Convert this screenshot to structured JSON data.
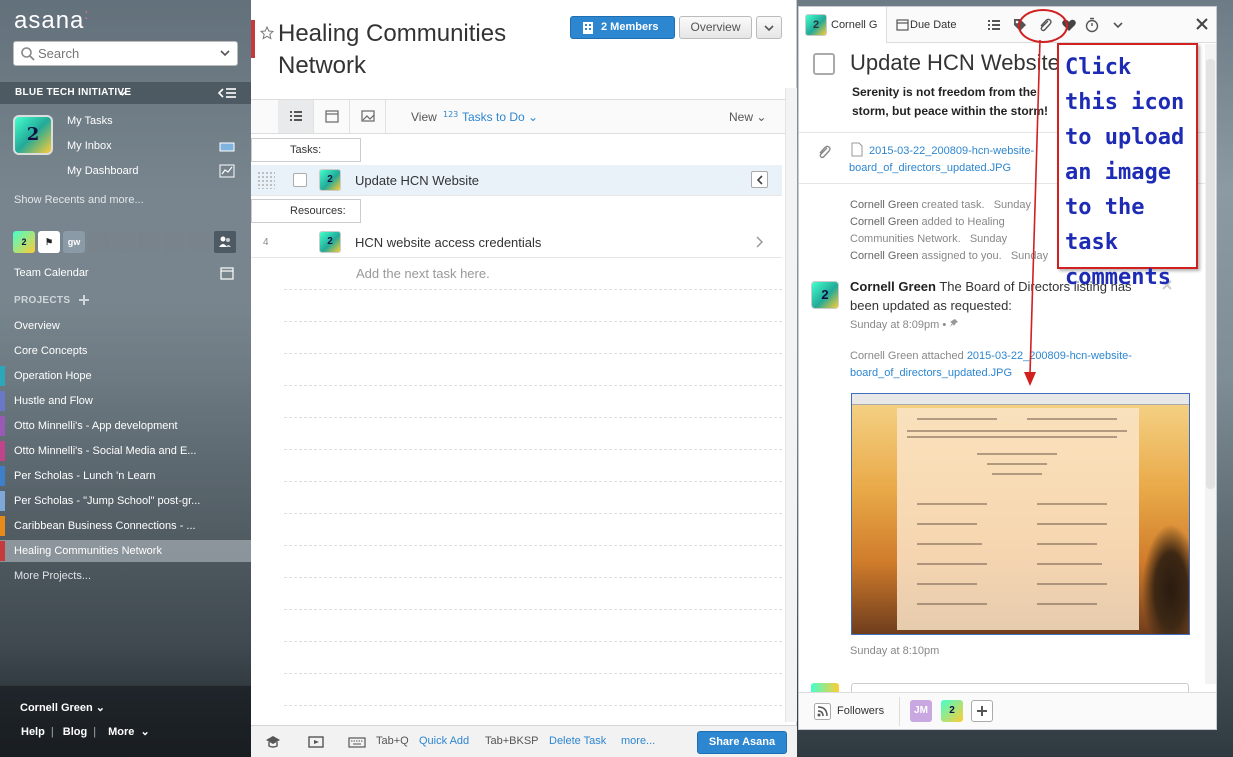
{
  "sidebar": {
    "logo": "asana",
    "search_placeholder": "Search",
    "org_name": "BLUE TECH INITIATIVE",
    "nav": [
      {
        "label": "My Tasks"
      },
      {
        "label": "My Inbox"
      },
      {
        "label": "My Dashboard"
      }
    ],
    "show_recents": "Show Recents and more...",
    "team_members": [
      "2st",
      "flag",
      "gw"
    ],
    "team_calendar": "Team Calendar",
    "projects_heading": "PROJECTS",
    "projects": [
      {
        "label": "Overview",
        "color": ""
      },
      {
        "label": "Core Concepts",
        "color": ""
      },
      {
        "label": "Operation Hope",
        "color": "#2aa7b8"
      },
      {
        "label": "Hustle and Flow",
        "color": "#6b78c8"
      },
      {
        "label": "Otto Minnelli's - App development",
        "color": "#9b59b6"
      },
      {
        "label": "Otto Minnelli's - Social Media and E...",
        "color": "#c0448b"
      },
      {
        "label": "Per Scholas - Lunch 'n Learn",
        "color": "#3d7fc9"
      },
      {
        "label": "Per Scholas - \"Jump School\" post-gr...",
        "color": "#7fa8d8"
      },
      {
        "label": "Caribbean Business Connections - ...",
        "color": "#e88a1a"
      },
      {
        "label": "Healing Communities Network",
        "color": "#c53b3b"
      }
    ],
    "more_projects": "More Projects...",
    "user_name": "Cornell Green",
    "footer": {
      "help": "Help",
      "blog": "Blog",
      "more": "More"
    }
  },
  "center": {
    "title": "Healing Communities Network",
    "members_button": "2 Members",
    "overview_button": "Overview",
    "view_label": "View",
    "view_selector": "Tasks to Do",
    "new_button": "New",
    "sections": [
      {
        "label": "Tasks:"
      },
      {
        "label": "Resources:"
      }
    ],
    "tasks": [
      {
        "name": "Update HCN Website"
      },
      {
        "number": "4",
        "name": "HCN website access credentials"
      }
    ],
    "add_task_placeholder": "Add the next task here.",
    "bottom": {
      "shortcut1_key": "Tab+Q",
      "shortcut1_action": "Quick Add",
      "shortcut2_key": "Tab+BKSP",
      "shortcut2_action": "Delete Task",
      "more": "more...",
      "share": "Share Asana"
    }
  },
  "task_pane": {
    "assignee": "Cornell G",
    "due_date": "Due Date",
    "title": "Update HCN Website",
    "description": "Serenity is not freedom from the storm, but peace within the storm!",
    "attachment_name": "2015-03-22_200809-hcn-website-board_of_directors_updated.JPG",
    "activity": [
      {
        "actor": "Cornell Green",
        "text": "created task.",
        "time": "Sunday"
      },
      {
        "actor": "Cornell Green",
        "text": "added to Healing Communities Network.",
        "time": "Sunday"
      },
      {
        "actor": "Cornell Green",
        "text": "assigned to you.",
        "time": "Sunday"
      }
    ],
    "comment": {
      "author": "Cornell Green",
      "text": "The Board of Directors listing has been updated as requested:",
      "time": "Sunday at 8:09pm"
    },
    "attach_event": {
      "actor": "Cornell Green",
      "verb": "attached",
      "file": "2015-03-22_200809-hcn-website-board_of_directors_updated.JPG"
    },
    "thumb_time": "Sunday at 8:10pm",
    "followers_label": "Followers",
    "followers": [
      "JM",
      "2st"
    ]
  },
  "annotation": {
    "text": "Click this icon to upload an image to the task comments"
  },
  "colors": {
    "brand_blue": "#2d86d0",
    "annotation_red": "#d02020",
    "annotation_text": "#1d2bb5",
    "project_accent": "#c53b3b"
  }
}
